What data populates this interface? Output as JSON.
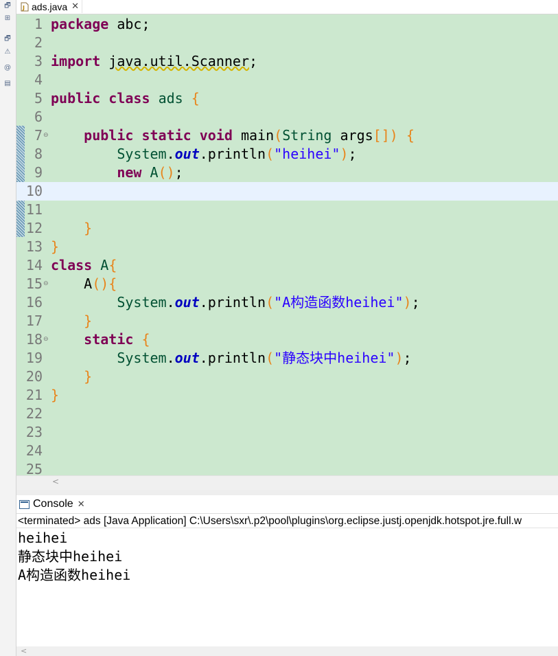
{
  "editor_tab": {
    "title": "ads.java",
    "close_glyph": "✕"
  },
  "left_strip_icons": [
    "restore-icon",
    "hierarchy-icon",
    "restore-icon",
    "error-log-icon",
    "javadoc-icon",
    "declaration-icon"
  ],
  "code_lines": [
    {
      "n": "1",
      "parts": [
        {
          "t": "package",
          "c": "kw"
        },
        {
          "t": " abc;",
          "c": ""
        }
      ]
    },
    {
      "n": "2",
      "parts": []
    },
    {
      "n": "3",
      "marker": "warning",
      "parts": [
        {
          "t": "import",
          "c": "kw"
        },
        {
          "t": " ",
          "c": ""
        },
        {
          "t": "java.util.Scanner",
          "c": "squig"
        },
        {
          "t": ";",
          "c": ""
        }
      ]
    },
    {
      "n": "4",
      "parts": []
    },
    {
      "n": "5",
      "parts": [
        {
          "t": "public",
          "c": "kw"
        },
        {
          "t": " ",
          "c": ""
        },
        {
          "t": "class",
          "c": "kw"
        },
        {
          "t": " ",
          "c": ""
        },
        {
          "t": "ads",
          "c": "cls"
        },
        {
          "t": " ",
          "c": ""
        },
        {
          "t": "{",
          "c": "par"
        }
      ]
    },
    {
      "n": "6",
      "parts": []
    },
    {
      "n": "7",
      "fold": true,
      "parts": [
        {
          "t": "    ",
          "c": ""
        },
        {
          "t": "public",
          "c": "kw"
        },
        {
          "t": " ",
          "c": ""
        },
        {
          "t": "static",
          "c": "kw"
        },
        {
          "t": " ",
          "c": ""
        },
        {
          "t": "void",
          "c": "kw"
        },
        {
          "t": " main",
          "c": ""
        },
        {
          "t": "(",
          "c": "par"
        },
        {
          "t": "String",
          "c": "cls"
        },
        {
          "t": " args",
          "c": ""
        },
        {
          "t": "[]",
          "c": "par"
        },
        {
          "t": ")",
          "c": "par"
        },
        {
          "t": " ",
          "c": ""
        },
        {
          "t": "{",
          "c": "par"
        }
      ]
    },
    {
      "n": "8",
      "parts": [
        {
          "t": "        ",
          "c": ""
        },
        {
          "t": "System",
          "c": "cls"
        },
        {
          "t": ".",
          "c": ""
        },
        {
          "t": "out",
          "c": "fld"
        },
        {
          "t": ".println",
          "c": ""
        },
        {
          "t": "(",
          "c": "par"
        },
        {
          "t": "\"heihei\"",
          "c": "str"
        },
        {
          "t": ")",
          "c": "par"
        },
        {
          "t": ";",
          "c": ""
        }
      ]
    },
    {
      "n": "9",
      "parts": [
        {
          "t": "        ",
          "c": ""
        },
        {
          "t": "new",
          "c": "kw"
        },
        {
          "t": " ",
          "c": ""
        },
        {
          "t": "A",
          "c": "cls"
        },
        {
          "t": "()",
          "c": "par"
        },
        {
          "t": ";",
          "c": ""
        }
      ]
    },
    {
      "n": "10",
      "current": true,
      "parts": []
    },
    {
      "n": "11",
      "parts": []
    },
    {
      "n": "12",
      "parts": [
        {
          "t": "    ",
          "c": ""
        },
        {
          "t": "}",
          "c": "par"
        }
      ]
    },
    {
      "n": "13",
      "parts": [
        {
          "t": "}",
          "c": "par"
        }
      ]
    },
    {
      "n": "14",
      "parts": [
        {
          "t": "class",
          "c": "kw"
        },
        {
          "t": " ",
          "c": ""
        },
        {
          "t": "A",
          "c": "cls"
        },
        {
          "t": "{",
          "c": "par"
        }
      ]
    },
    {
      "n": "15",
      "fold": true,
      "parts": [
        {
          "t": "    A",
          "c": ""
        },
        {
          "t": "(){",
          "c": "par"
        }
      ]
    },
    {
      "n": "16",
      "parts": [
        {
          "t": "        ",
          "c": ""
        },
        {
          "t": "System",
          "c": "cls"
        },
        {
          "t": ".",
          "c": ""
        },
        {
          "t": "out",
          "c": "fld"
        },
        {
          "t": ".println",
          "c": ""
        },
        {
          "t": "(",
          "c": "par"
        },
        {
          "t": "\"A",
          "c": "str"
        },
        {
          "t": "构造函数",
          "c": "str cjk"
        },
        {
          "t": "heihei\"",
          "c": "str"
        },
        {
          "t": ")",
          "c": "par"
        },
        {
          "t": ";",
          "c": ""
        }
      ]
    },
    {
      "n": "17",
      "parts": [
        {
          "t": "    ",
          "c": ""
        },
        {
          "t": "}",
          "c": "par"
        }
      ]
    },
    {
      "n": "18",
      "fold": true,
      "parts": [
        {
          "t": "    ",
          "c": ""
        },
        {
          "t": "static",
          "c": "kw"
        },
        {
          "t": " ",
          "c": ""
        },
        {
          "t": "{",
          "c": "par"
        }
      ]
    },
    {
      "n": "19",
      "parts": [
        {
          "t": "        ",
          "c": ""
        },
        {
          "t": "System",
          "c": "cls"
        },
        {
          "t": ".",
          "c": ""
        },
        {
          "t": "out",
          "c": "fld"
        },
        {
          "t": ".println",
          "c": ""
        },
        {
          "t": "(",
          "c": "par"
        },
        {
          "t": "\"",
          "c": "str"
        },
        {
          "t": "静态块中",
          "c": "str cjk"
        },
        {
          "t": "heihei\"",
          "c": "str"
        },
        {
          "t": ")",
          "c": "par"
        },
        {
          "t": ";",
          "c": ""
        }
      ]
    },
    {
      "n": "20",
      "parts": [
        {
          "t": "    ",
          "c": ""
        },
        {
          "t": "}",
          "c": "par"
        }
      ]
    },
    {
      "n": "21",
      "parts": [
        {
          "t": "}",
          "c": "par"
        }
      ]
    },
    {
      "n": "22",
      "parts": []
    },
    {
      "n": "23",
      "parts": []
    },
    {
      "n": "24",
      "parts": []
    },
    {
      "n": "25",
      "parts": []
    }
  ],
  "editor_scroll_left_glyph": "<",
  "console": {
    "tab_title": "Console",
    "close_glyph": "✕",
    "status": "<terminated> ads [Java Application] C:\\Users\\sxr\\.p2\\pool\\plugins\\org.eclipse.justj.openjdk.hotspot.jre.full.w",
    "output_lines": [
      [
        {
          "t": "heihei",
          "c": ""
        }
      ],
      [
        {
          "t": "静态块中",
          "c": "cjk"
        },
        {
          "t": "heihei",
          "c": ""
        }
      ],
      [
        {
          "t": "A",
          "c": ""
        },
        {
          "t": "构造函数",
          "c": "cjk"
        },
        {
          "t": "heihei",
          "c": ""
        }
      ]
    ],
    "scroll_left_glyph": "<"
  },
  "colors": {
    "editor_bg": "#cce8cf",
    "current_line": "#e8f2fe",
    "keyword": "#7f0055",
    "string": "#2a00ff",
    "field": "#0000c0",
    "bracket": "#e8841b",
    "type": "#005032"
  }
}
